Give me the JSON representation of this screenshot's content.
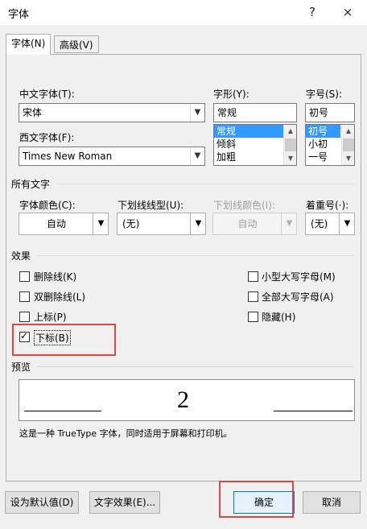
{
  "window": {
    "title": "字体",
    "help": "?",
    "close": "×"
  },
  "tabs": [
    {
      "label": "字体(N)",
      "active": true
    },
    {
      "label": "高级(V)",
      "active": false
    }
  ],
  "font": {
    "cn_font_label": "中文字体(T):",
    "cn_font_value": "宋体",
    "west_font_label": "西文字体(F):",
    "west_font_value": "Times New Roman",
    "style_label": "字形(Y):",
    "style_value": "常规",
    "style_options": [
      "常规",
      "倾斜",
      "加粗"
    ],
    "size_label": "字号(S):",
    "size_value": "初号",
    "size_options": [
      "初号",
      "小初",
      "一号"
    ]
  },
  "all_text": {
    "section_label": "所有文字",
    "color_label": "字体颜色(C):",
    "color_value": "自动",
    "underline_type_label": "下划线线型(U):",
    "underline_type_value": "(无)",
    "underline_color_label": "下划线颜色(I):",
    "underline_color_value": "自动",
    "emphasis_label": "着重号(·):",
    "emphasis_value": "(无)"
  },
  "effects": {
    "section_label": "效果",
    "items": [
      {
        "label": "删除线(K)",
        "checked": false
      },
      {
        "label": "双删除线(L)",
        "checked": false
      },
      {
        "label": "上标(P)",
        "checked": false
      },
      {
        "label": "下标(B)",
        "checked": true
      },
      {
        "label": "小型大写字母(M)",
        "checked": false
      },
      {
        "label": "全部大写字母(A)",
        "checked": false
      },
      {
        "label": "隐藏(H)",
        "checked": false
      }
    ]
  },
  "preview": {
    "section_label": "预览",
    "sample": "2",
    "description": "这是一种 TrueType 字体，同时适用于屏幕和打印机。"
  },
  "buttons": {
    "set_default": "设为默认值(D)",
    "text_effects": "文字效果(E)...",
    "ok": "确定",
    "cancel": "取消"
  },
  "colors": {
    "highlight_box": "#e04646",
    "selection": "#3399ff"
  }
}
